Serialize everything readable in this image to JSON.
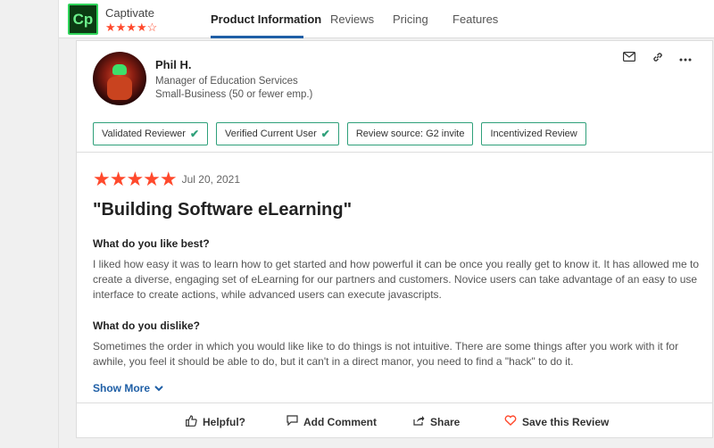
{
  "header": {
    "product_name": "Captivate",
    "logo_text": "Cp",
    "rating_stars": "★★★★☆",
    "tabs": [
      {
        "label": "Product Information",
        "active": true
      },
      {
        "label": "Reviews",
        "active": false
      },
      {
        "label": "Pricing",
        "active": false
      },
      {
        "label": "Features",
        "active": false
      }
    ]
  },
  "reviewer": {
    "name": "Phil H.",
    "title": "Manager of Education Services",
    "company_size": "Small-Business (50 or fewer emp.)"
  },
  "card_icons": [
    "mail-icon",
    "link-icon",
    "more-icon"
  ],
  "badges": [
    {
      "label": "Validated Reviewer",
      "check": true
    },
    {
      "label": "Verified Current User",
      "check": true
    },
    {
      "label": "Review source: G2 invite",
      "check": false
    },
    {
      "label": "Incentivized Review",
      "check": false
    }
  ],
  "review": {
    "stars": "★★★★★",
    "date": "Jul 20, 2021",
    "title": "\"Building Software eLearning\"",
    "like_question": "What do you like best?",
    "like_answer": "I liked how easy it was to learn how to get started and how powerful it can be once you really get to know it. It has allowed me to create a diverse, engaging set of eLearning for our partners and customers. Novice users can take advantage of an easy to use interface to create actions, while advanced users can execute javascripts.",
    "dislike_question": "What do you dislike?",
    "dislike_answer": "Sometimes the order in which you would like like to do things is not intuitive. There are some things after you work with it for awhile, you feel it should be able to do, but it can't in a direct manor, you need to find a \"hack\" to do it.",
    "show_more": "Show More"
  },
  "actions": {
    "helpful": "Helpful?",
    "add_comment": "Add Comment",
    "share": "Share",
    "save": "Save this Review"
  },
  "colors": {
    "accent_blue": "#1f5fa6",
    "star_red": "#ff492c",
    "badge_green": "#2fa07a"
  }
}
